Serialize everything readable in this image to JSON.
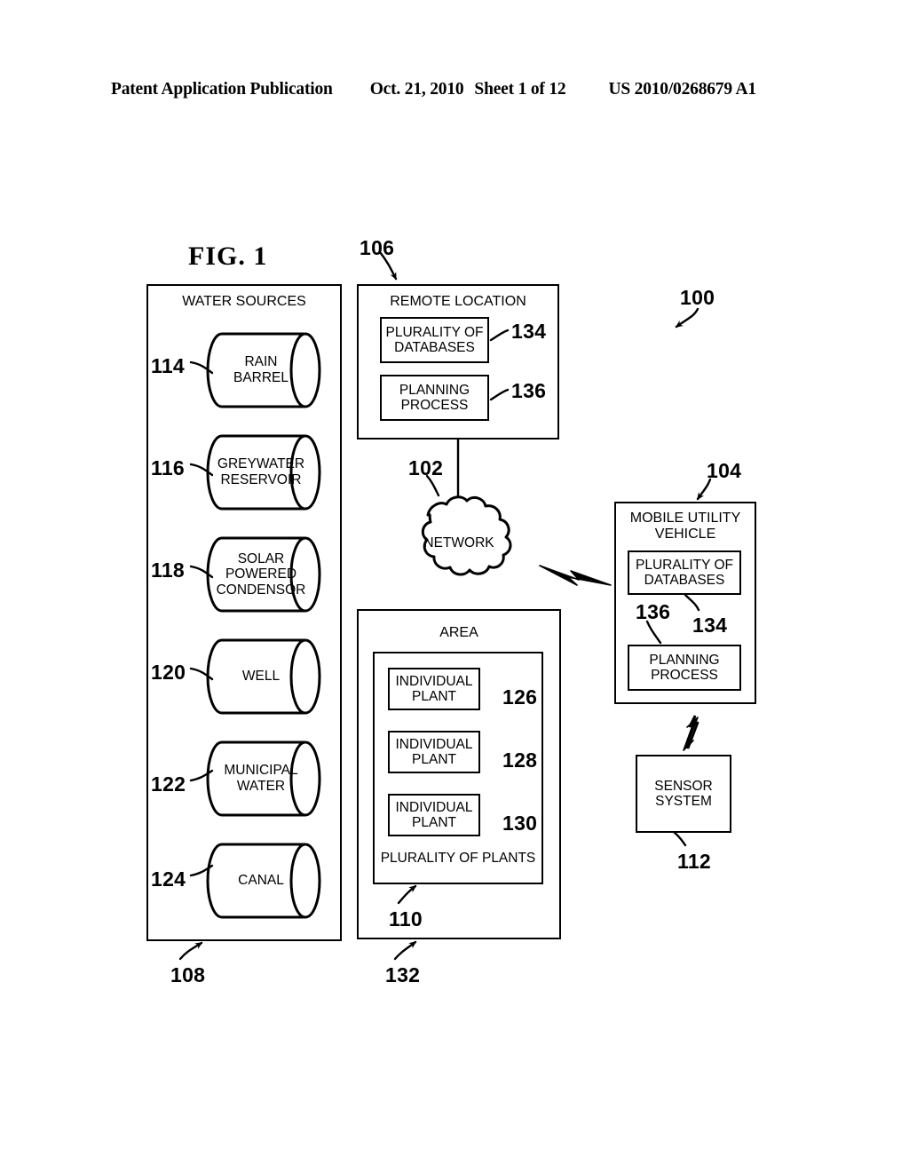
{
  "header": {
    "publication": "Patent Application Publication",
    "date": "Oct. 21, 2010",
    "sheet": "Sheet 1 of 12",
    "number": "US 2010/0268679 A1"
  },
  "figure": {
    "title": "FIG. 1",
    "system_ref": "100"
  },
  "water_sources": {
    "title": "WATER SOURCES",
    "container_ref": "108",
    "items": [
      {
        "ref": "114",
        "label": "RAIN\nBARREL",
        "line1": "RAIN",
        "line2": "BARREL"
      },
      {
        "ref": "116",
        "label": "GREYWATER RESERVOIR",
        "line1": "GREYWATER",
        "line2": "RESERVOIR"
      },
      {
        "ref": "118",
        "label": "SOLAR POWERED CONDENSOR",
        "line1": "SOLAR",
        "line2": "POWERED",
        "line3": "CONDENSOR"
      },
      {
        "ref": "120",
        "label": "WELL",
        "line1": "WELL",
        "line2": ""
      },
      {
        "ref": "122",
        "label": "MUNICIPAL WATER",
        "line1": "MUNICIPAL",
        "line2": "WATER"
      },
      {
        "ref": "124",
        "label": "CANAL",
        "line1": "CANAL",
        "line2": ""
      }
    ]
  },
  "remote_location": {
    "title": "REMOTE LOCATION",
    "ref": "106",
    "databases": {
      "line1": "PLURALITY OF",
      "line2": "DATABASES",
      "ref": "134"
    },
    "planning": {
      "line1": "PLANNING",
      "line2": "PROCESS",
      "ref": "136"
    }
  },
  "network": {
    "label": "NETWORK",
    "ref": "102"
  },
  "area": {
    "title": "AREA",
    "ref": "132",
    "plants_group": {
      "label": "PLURALITY OF PLANTS",
      "ref": "110",
      "plants": [
        {
          "line1": "INDIVIDUAL",
          "line2": "PLANT",
          "ref": "126"
        },
        {
          "line1": "INDIVIDUAL",
          "line2": "PLANT",
          "ref": "128"
        },
        {
          "line1": "INDIVIDUAL",
          "line2": "PLANT",
          "ref": "130"
        }
      ]
    }
  },
  "mobile_utility_vehicle": {
    "title_line1": "MOBILE UTILITY",
    "title_line2": "VEHICLE",
    "ref": "104",
    "databases": {
      "line1": "PLURALITY OF",
      "line2": "DATABASES",
      "ref": "134"
    },
    "planning": {
      "line1": "PLANNING",
      "line2": "PROCESS",
      "ref": "136"
    }
  },
  "sensor_system": {
    "line1": "SENSOR",
    "line2": "SYSTEM",
    "ref": "112"
  },
  "colors": {
    "ink": "#000000",
    "paper": "#ffffff"
  }
}
